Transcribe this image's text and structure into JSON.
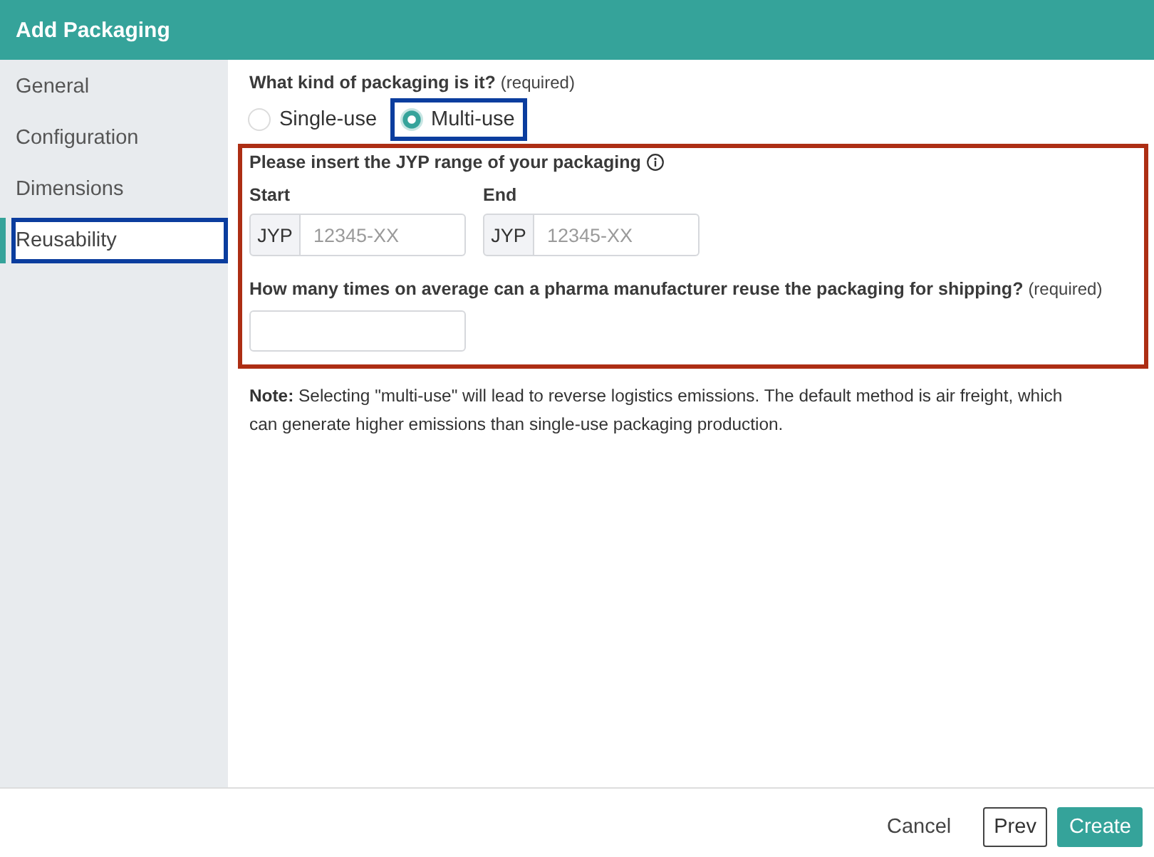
{
  "window": {
    "title": "Add Packaging"
  },
  "sidebar": {
    "items": [
      {
        "label": "General",
        "selected": false,
        "highlighted": false
      },
      {
        "label": "Configuration",
        "selected": false,
        "highlighted": false
      },
      {
        "label": "Dimensions",
        "selected": false,
        "highlighted": false
      },
      {
        "label": "Reusability",
        "selected": true,
        "highlighted": true
      }
    ]
  },
  "packaging_kind": {
    "label": "What kind of packaging is it?",
    "hint": "(required)",
    "options": [
      {
        "label": "Single-use",
        "selected": false,
        "highlighted": false
      },
      {
        "label": "Multi-use",
        "selected": true,
        "highlighted": true
      }
    ]
  },
  "range_section": {
    "highlighted": true,
    "label": "Please insert the JYP range of your packaging",
    "fields": [
      {
        "label": "Start",
        "prefix": "JYP",
        "placeholder": "12345-XX"
      },
      {
        "label": "End",
        "prefix": "JYP",
        "placeholder": "12345-XX"
      }
    ],
    "reuse_question": {
      "label": "How many times on average can a pharma manufacturer reuse the packaging for shipping?",
      "hint": "(required)"
    }
  },
  "note": "**Note:** Selecting \"multi-use\" will lead to reverse logistics emissions. The default method is air freight, which can generate higher emissions than single-use packaging production.",
  "buttons": [
    {
      "label": "Cancel",
      "kind": "link"
    },
    {
      "label": "Prev",
      "kind": "outline"
    },
    {
      "label": "Create",
      "kind": "primary"
    }
  ]
}
